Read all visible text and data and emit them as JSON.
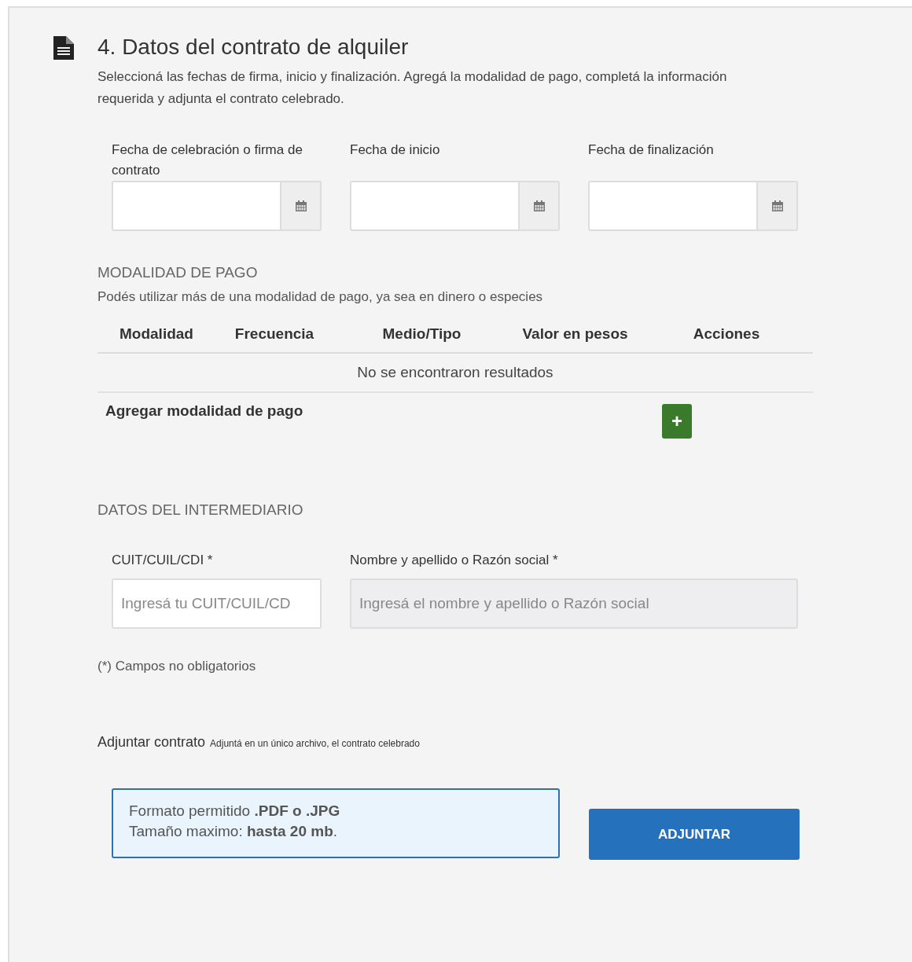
{
  "section": {
    "title": "4. Datos del contrato de alquiler",
    "description": "Seleccioná las fechas de firma, inicio y finalización. Agregá la modalidad de pago, completá la información requerida y adjunta el contrato celebrado."
  },
  "date_fields": [
    {
      "label": "Fecha de celebración o firma de contrato"
    },
    {
      "label": "Fecha de inicio"
    },
    {
      "label": "Fecha de finalización"
    }
  ],
  "payment": {
    "heading": "MODALIDAD DE PAGO",
    "hint": "Podés utilizar más de una modalidad de pago, ya sea en dinero o especies",
    "columns": [
      "Modalidad",
      "Frecuencia",
      "Medio/Tipo",
      "Valor en pesos",
      "Acciones"
    ],
    "empty_message": "No se encontraron resultados",
    "add_label": "Agregar modalidad de pago",
    "add_button": "+"
  },
  "intermediary": {
    "heading": "DATOS DEL INTERMEDIARIO",
    "fields": [
      {
        "label": "CUIT/CUIL/CDI *",
        "placeholder": "Ingresá tu CUIT/CUIL/CD",
        "disabled": false
      },
      {
        "label": "Nombre y apellido o Razón social *",
        "placeholder": "Ingresá el nombre y apellido o Razón social",
        "disabled": true
      }
    ],
    "note": "(*) Campos no obligatorios"
  },
  "attachment": {
    "label": "Adjuntar contrato",
    "hint": "Adjuntá en un único archivo, el contrato celebrado",
    "format_line": "Formato permitido **.PDF o .JPG**",
    "size_line": "Tamaño maximo: **hasta 20 mb**.",
    "button": "ADJUNTAR"
  }
}
